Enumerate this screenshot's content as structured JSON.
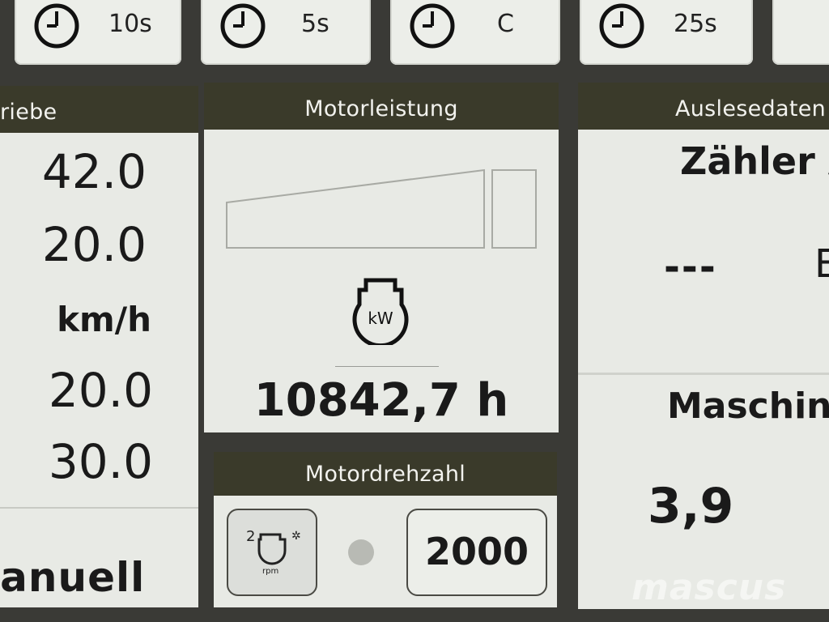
{
  "timers": [
    {
      "label": "10s",
      "icon": "clock-icon"
    },
    {
      "label": "5s",
      "icon": "clock-icon"
    },
    {
      "label": "C",
      "icon": "clock-icon"
    },
    {
      "label": "25s",
      "icon": "clock-icon"
    }
  ],
  "left_panel": {
    "title": "riebe",
    "values": [
      "42.0",
      "20.0",
      "20.0",
      "30.0"
    ],
    "unit": "km/h",
    "mode": "lanuell"
  },
  "engine_power": {
    "title": "Motorleistung",
    "gauge_level": 0,
    "icon": "engine-kw-icon",
    "hours": "10842,7 h"
  },
  "engine_rpm": {
    "title": "Motordrehzahl",
    "mode_icon": "rpm-mode-icon",
    "value": "2000"
  },
  "right_panel": {
    "title": "Auslesedaten",
    "counter_label": "Zähler A",
    "counter_value": "---",
    "machine_label": "Maschin",
    "machine_value": "3,9",
    "partial_glyph": "E"
  },
  "watermark": "mascus",
  "colors": {
    "header_bg": "#3a3a2a",
    "panel_bg": "#e8eae5",
    "frame_bg": "#3a3a36"
  }
}
